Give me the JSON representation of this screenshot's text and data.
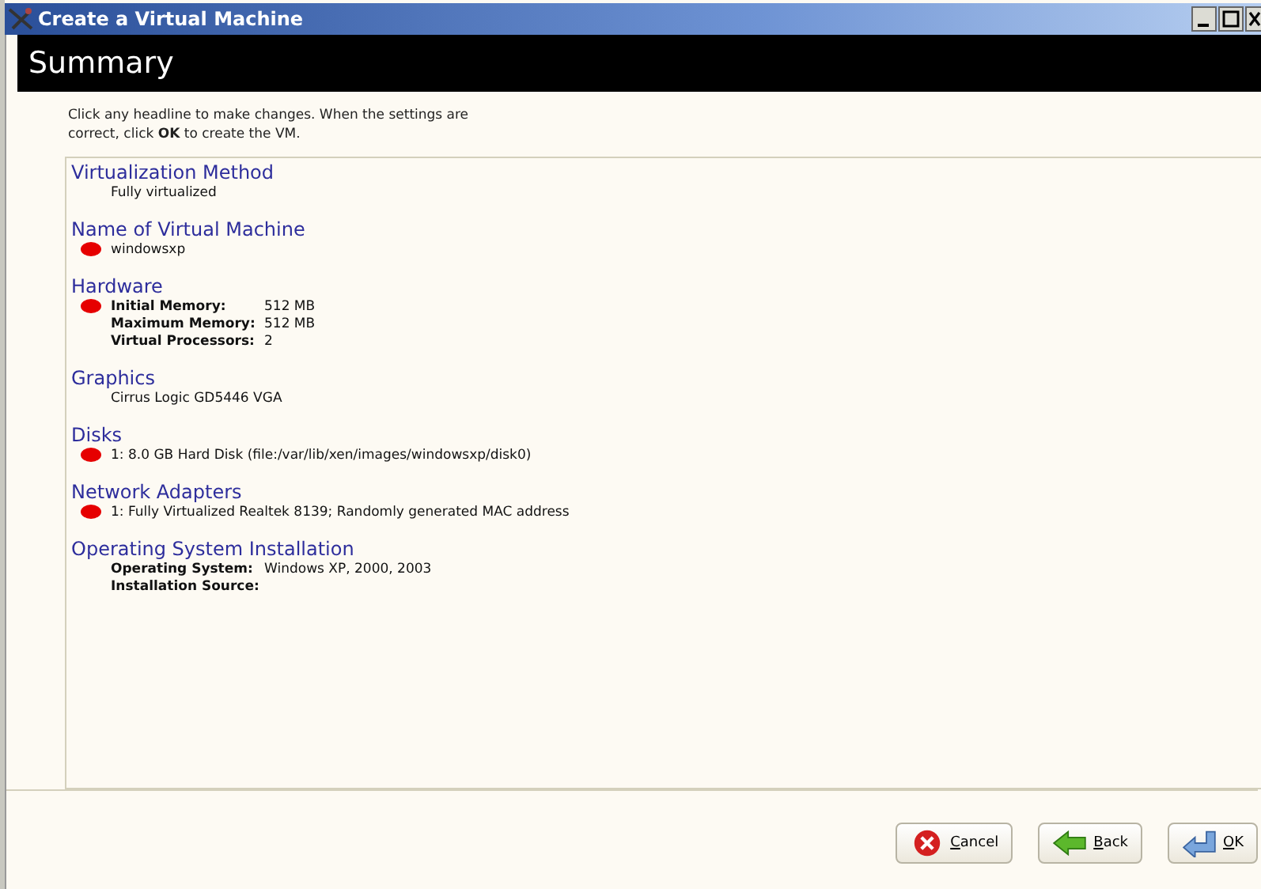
{
  "window": {
    "title": "Create a Virtual Machine"
  },
  "header": {
    "title": "Summary"
  },
  "intro": "Click any headline to make changes.  When the settings are correct, click **OK** to create the VM.",
  "sections": [
    {
      "heading": "Virtualization Method",
      "lines": [
        {
          "kind": "text",
          "text": "Fully virtualized",
          "marked": false
        }
      ]
    },
    {
      "heading": "Name of Virtual Machine",
      "lines": [
        {
          "kind": "text",
          "text": "windowsxp",
          "marked": true
        }
      ]
    },
    {
      "heading": "Hardware",
      "lines": [
        {
          "kind": "field",
          "label": "Initial Memory:",
          "value": "512 MB",
          "marked": true
        },
        {
          "kind": "field",
          "label": "Maximum Memory:",
          "value": "512 MB",
          "marked": false
        },
        {
          "kind": "field",
          "label": "Virtual Processors:",
          "value": "2",
          "marked": false
        }
      ]
    },
    {
      "heading": "Graphics",
      "lines": [
        {
          "kind": "text",
          "text": "Cirrus Logic GD5446 VGA",
          "marked": false
        }
      ]
    },
    {
      "heading": "Disks",
      "lines": [
        {
          "kind": "text",
          "text": "1: 8.0 GB Hard Disk (file:/var/lib/xen/images/windowsxp/disk0)",
          "marked": true
        }
      ]
    },
    {
      "heading": "Network Adapters",
      "lines": [
        {
          "kind": "text",
          "text": "1: Fully Virtualized Realtek 8139; Randomly generated MAC address",
          "marked": true
        }
      ]
    },
    {
      "heading": "Operating System Installation",
      "lines": [
        {
          "kind": "field",
          "label": "Operating System:",
          "value": "Windows XP, 2000, 2003",
          "marked": false
        },
        {
          "kind": "field",
          "label": "Installation Source:",
          "marked": false
        }
      ]
    }
  ],
  "buttons": [
    {
      "kind": "cancel",
      "label": "Cancel"
    },
    {
      "kind": "back",
      "label": "Back"
    },
    {
      "kind": "ok",
      "label": "OK"
    }
  ]
}
